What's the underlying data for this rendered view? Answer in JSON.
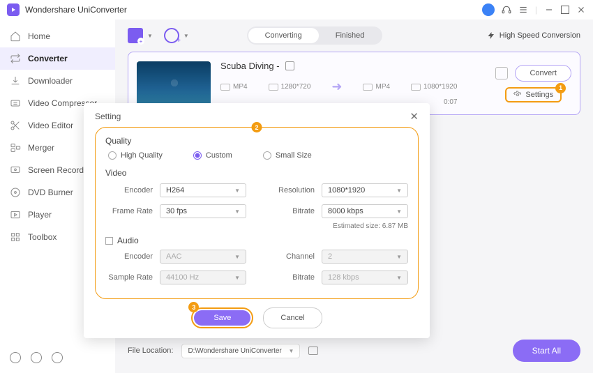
{
  "titlebar": {
    "app_name": "Wondershare UniConverter"
  },
  "sidebar": {
    "items": [
      {
        "label": "Home"
      },
      {
        "label": "Converter"
      },
      {
        "label": "Downloader"
      },
      {
        "label": "Video Compressor"
      },
      {
        "label": "Video Editor"
      },
      {
        "label": "Merger"
      },
      {
        "label": "Screen Recorder"
      },
      {
        "label": "DVD Burner"
      },
      {
        "label": "Player"
      },
      {
        "label": "Toolbox"
      }
    ]
  },
  "toolbar": {
    "tabs": {
      "converting": "Converting",
      "finished": "Finished"
    },
    "high_speed": "High Speed Conversion"
  },
  "media": {
    "title": "Scuba Diving -",
    "src_format": "MP4",
    "src_res": "1280*720",
    "dst_format": "MP4",
    "dst_res": "1080*1920",
    "duration": "0:07",
    "convert_label": "Convert",
    "settings_label": "Settings"
  },
  "callouts": {
    "one": "1",
    "two": "2",
    "three": "3"
  },
  "modal": {
    "title": "Setting",
    "quality_label": "Quality",
    "quality": {
      "high": "High Quality",
      "custom": "Custom",
      "small": "Small Size"
    },
    "video_label": "Video",
    "video": {
      "encoder_label": "Encoder",
      "encoder": "H264",
      "framerate_label": "Frame Rate",
      "framerate": "30 fps",
      "resolution_label": "Resolution",
      "resolution": "1080*1920",
      "bitrate_label": "Bitrate",
      "bitrate": "8000 kbps"
    },
    "estimated": "Estimated size: 6.87 MB",
    "audio_label": "Audio",
    "audio": {
      "encoder_label": "Encoder",
      "encoder": "AAC",
      "samplerate_label": "Sample Rate",
      "samplerate": "44100 Hz",
      "channel_label": "Channel",
      "channel": "2",
      "bitrate_label": "Bitrate",
      "bitrate": "128 kbps"
    },
    "save": "Save",
    "cancel": "Cancel"
  },
  "footer": {
    "file_location_label": "File Location:",
    "file_location": "D:\\Wondershare UniConverter",
    "start_all": "Start All"
  }
}
